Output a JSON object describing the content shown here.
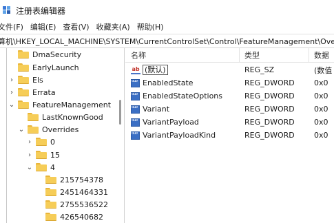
{
  "window": {
    "title": "注册表编辑器"
  },
  "menu": [
    "文件(F)",
    "编辑(E)",
    "查看(V)",
    "收藏夹(A)",
    "帮助(H)"
  ],
  "address": "算机\\HKEY_LOCAL_MACHINE\\SYSTEM\\CurrentControlSet\\Control\\FeatureManagement\\Overr",
  "tree": [
    {
      "label": "DmaSecurity",
      "expander": ""
    },
    {
      "label": "EarlyLaunch",
      "expander": ""
    },
    {
      "label": "Els",
      "expander": ">"
    },
    {
      "label": "Errata",
      "expander": ">"
    },
    {
      "label": "FeatureManagement",
      "expander": "v"
    },
    {
      "label": "LastKnownGood",
      "expander": ""
    },
    {
      "label": "Overrides",
      "expander": "v"
    },
    {
      "label": "0",
      "expander": ">"
    },
    {
      "label": "15",
      "expander": ">"
    },
    {
      "label": "4",
      "expander": "v"
    },
    {
      "label": "215754378",
      "expander": ""
    },
    {
      "label": "2451464331",
      "expander": ""
    },
    {
      "label": "2755536522",
      "expander": ""
    },
    {
      "label": "426540682",
      "expander": ""
    }
  ],
  "columns": {
    "name": "名称",
    "type": "类型",
    "data": "数据"
  },
  "values": [
    {
      "name": "(默认)",
      "type": "REG_SZ",
      "data": "(数值",
      "icon": "string-value-icon"
    },
    {
      "name": "EnabledState",
      "type": "REG_DWORD",
      "data": "0x0",
      "icon": "binary-value-icon"
    },
    {
      "name": "EnabledStateOptions",
      "type": "REG_DWORD",
      "data": "0x0",
      "icon": "binary-value-icon"
    },
    {
      "name": "Variant",
      "type": "REG_DWORD",
      "data": "0x0",
      "icon": "binary-value-icon"
    },
    {
      "name": "VariantPayload",
      "type": "REG_DWORD",
      "data": "0x0",
      "icon": "binary-value-icon"
    },
    {
      "name": "VariantPayloadKind",
      "type": "REG_DWORD",
      "data": "0x0",
      "icon": "binary-value-icon"
    }
  ]
}
